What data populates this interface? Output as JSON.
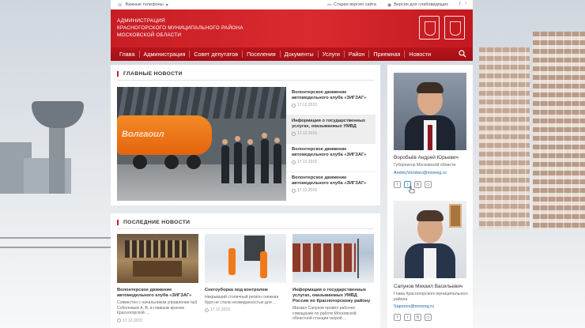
{
  "topbar": {
    "phones_label": "Важные телефоны",
    "old_version": "Старая версия сайта",
    "low_vision": "Версия для слабовидящих"
  },
  "header": {
    "title_lines": [
      "Администрация",
      "Красногорского муниципального района",
      "Московской области"
    ]
  },
  "nav": {
    "items": [
      "Главa",
      "Администрация",
      "Совет депутатов",
      "Поселения",
      "Документы",
      "Услуги",
      "Район",
      "Приемная",
      "Новости"
    ]
  },
  "main_news": {
    "section_title": "ГЛАВНЫЕ НОВОСТИ",
    "hero_truck_text": "Волгаоил",
    "items": [
      {
        "title": "Волонтерское движение автомодельного клуба «ЗИГЗАГ»",
        "date": "17.12.2015"
      },
      {
        "title": "Информация о государственных услугах, оказываемых УМВД",
        "date": "17.12.2015"
      },
      {
        "title": "Волонтерское движение автомодельного клуба «ЗИГЗАГ»",
        "date": "17.12.2015"
      },
      {
        "title": "Волонтерское движение автомодельного клуба «ЗИГЗАГ»",
        "date": "17.12.2015"
      }
    ]
  },
  "latest_news": {
    "section_title": "ПОСЛЕДНИЕ НОВОСТИ",
    "cards": [
      {
        "title": "Волонтерское движение автомодельного клуба «ЗИГЗАГ»",
        "text": "Совместно с начальником управления №9 Соболевым А. В. и главным врачом Красногорской ...",
        "date": "17.12.2015"
      },
      {
        "title": "Снегоуборка под контролем",
        "text": "Накрывший столичный регион снежная буря не стала неожиданностью для ...",
        "date": "17.12.2015"
      },
      {
        "title": "Информация о государственных услугах, оказываемых УМВД России по Красногорскому району",
        "text": "Михаил Сапунов провёл рабочее совещание по работе Московской областной станции скорой ...",
        "date": ""
      }
    ]
  },
  "sidebar": {
    "person1": {
      "name": "Воробьёв Андрей Юрьевич",
      "role": "Губернатор Московской области",
      "email": "AndreyVorobev@mosreg.ru"
    },
    "person2": {
      "name": "Сапунов Михаил Васильевич",
      "role": "Глава Красногорского муниципального района",
      "email": "Sapunov@mosreg.ru"
    },
    "social_icons": [
      "facebook-icon",
      "twitter-icon",
      "vk-icon",
      "instagram-icon"
    ]
  },
  "colors": {
    "brand_red": "#c81d25",
    "nav_red": "#a30f15",
    "link_blue": "#1a62a8"
  }
}
